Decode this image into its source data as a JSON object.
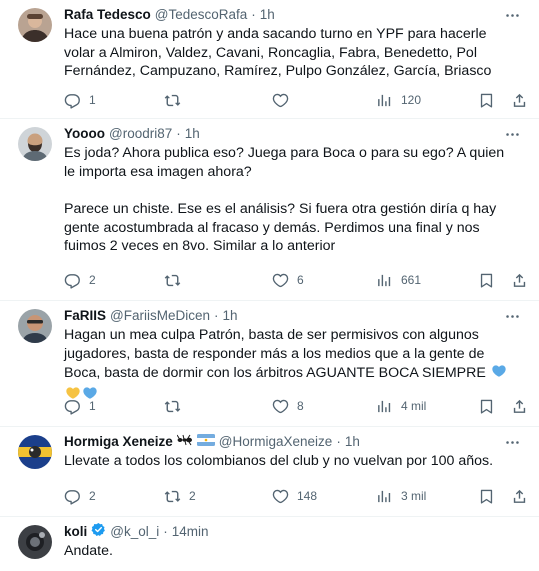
{
  "tweets": [
    {
      "name": "Rafa Tedesco",
      "handle": "@TedescoRafa",
      "time": "1h",
      "paragraphs": [
        "Hace una buena patrón y anda sacando turno en YPF para hacerle volar a Almiron, Valdez, Cavani, Roncaglia, Fabra, Benedetto, Pol Fernández, Campuzano, Ramírez, Pulpo González, García, Briasco"
      ],
      "replies": "1",
      "retweets": "",
      "likes": "",
      "views": "120"
    },
    {
      "name": "Yoooo",
      "handle": "@roodri87",
      "time": "1h",
      "paragraphs": [
        "Es joda? Ahora publica eso? Juega para Boca o para su ego? A quien le importa esa imagen ahora?",
        "Parece un chiste. Ese es el análisis? Si fuera otra gestión diría q hay gente acostumbrada al fracaso y demás. Perdimos una final y nos fuimos 2 veces en 8vo. Similar a lo anterior"
      ],
      "replies": "2",
      "retweets": "",
      "likes": "6",
      "views": "661"
    },
    {
      "name": "FaRIIS",
      "handle": "@FariisMeDicen",
      "time": "1h",
      "paragraphs": [
        "Hagan un mea culpa Patrón, basta de ser permisivos con algunos jugadores, basta de responder más a los medios que a la gente de Boca, basta de dormir con los árbitros AGUANTE BOCA SIEMPRE"
      ],
      "emoji": [
        "blue-heart",
        "yellow-heart",
        "blue-heart"
      ],
      "replies": "1",
      "retweets": "",
      "likes": "8",
      "views": "4 mil"
    },
    {
      "name": "Hormiga Xeneize",
      "handle": "@HormigaXeneize",
      "time": "1h",
      "name_icons": [
        "ant-icon",
        "argentina-flag-icon"
      ],
      "paragraphs": [
        "Llevate a todos los colombianos del club y no vuelvan por 100 años."
      ],
      "replies": "2",
      "retweets": "2",
      "likes": "148",
      "views": "3 mil"
    },
    {
      "name": "koli",
      "handle": "@k_ol_i",
      "time": "14min",
      "verified": true,
      "paragraphs": [
        "Andate."
      ]
    }
  ],
  "colors": {
    "text": "#0f1419",
    "muted": "#536471",
    "divider": "#eff3f4",
    "verified": "#1d9bf0",
    "blue_heart": "#5aa9e6",
    "yellow_heart": "#f6c343"
  },
  "icons": {
    "more": "more-icon",
    "reply": "reply-icon",
    "retweet": "retweet-icon",
    "like": "like-icon",
    "views": "views-icon",
    "bookmark": "bookmark-icon",
    "share": "share-icon"
  }
}
